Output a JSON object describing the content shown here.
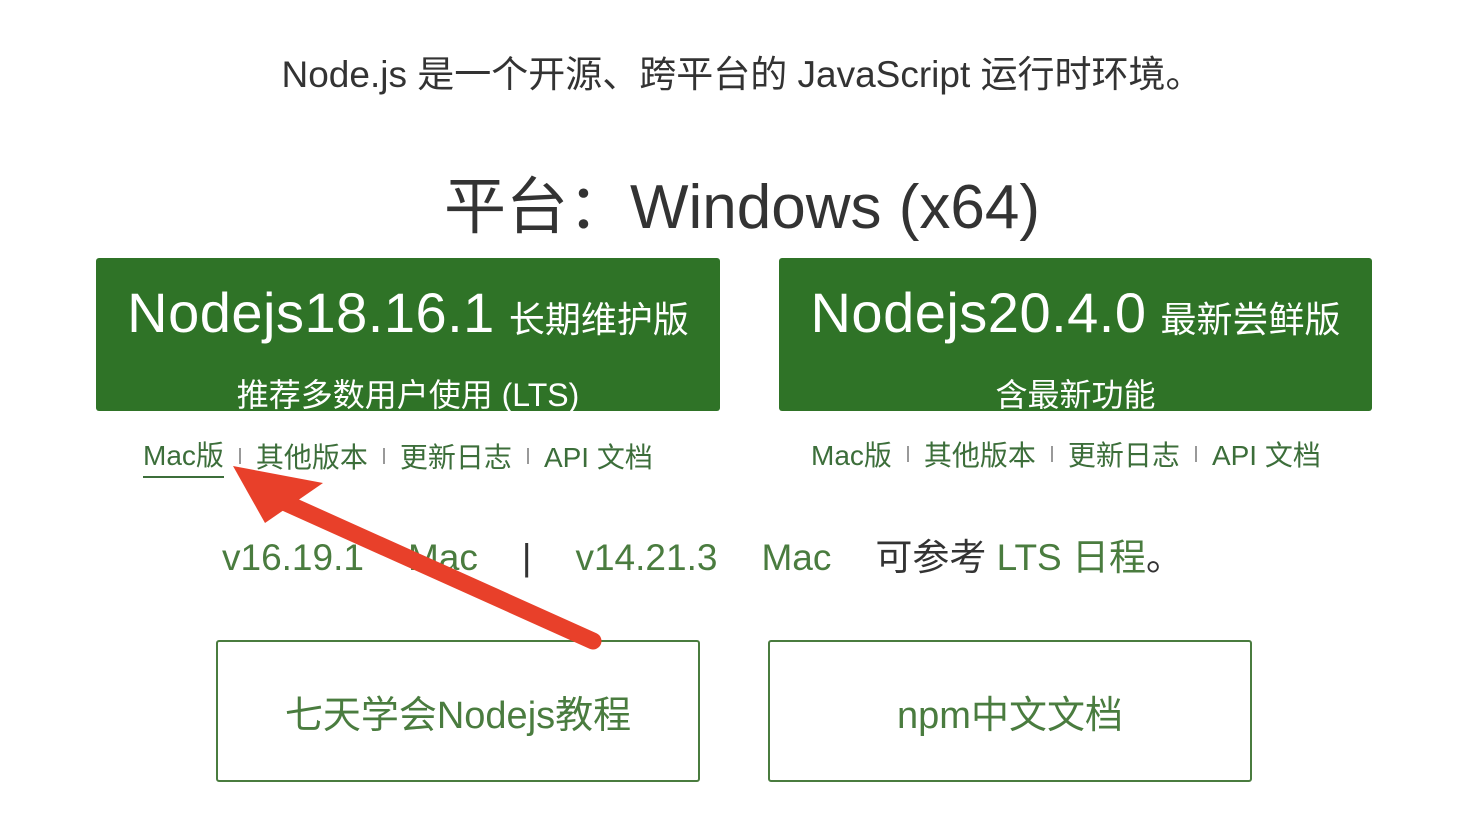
{
  "intro_text": "Node.js 是一个开源、跨平台的 JavaScript 运行时环境。",
  "platform": {
    "label": "平台：",
    "value": "Windows (x64)"
  },
  "downloads": {
    "lts": {
      "version": "Nodejs18.16.1",
      "tag": "长期维护版",
      "subtitle": "推荐多数用户使用 (LTS)"
    },
    "current": {
      "version": "Nodejs20.4.0",
      "tag": "最新尝鲜版",
      "subtitle": "含最新功能"
    }
  },
  "links": {
    "mac": "Mac版",
    "other_versions": "其他版本",
    "changelog": "更新日志",
    "api_docs": "API 文档"
  },
  "old_versions": {
    "v16": "v16.19.1",
    "v16_mac": "Mac",
    "separator": "|",
    "v14": "v14.21.3",
    "v14_mac": "Mac",
    "schedule_prefix": "可参考",
    "schedule_link": "LTS 日程",
    "schedule_suffix": "。"
  },
  "bottom_buttons": {
    "tutorial": "七天学会Nodejs教程",
    "npm_docs": "npm中文文档"
  },
  "colors": {
    "primary_green": "#2f7327",
    "link_green": "#3c6e3a",
    "text_green": "#4a7c3f",
    "annotation_arrow": "#e8402a"
  },
  "annotation": {
    "icon": "arrow-icon"
  }
}
